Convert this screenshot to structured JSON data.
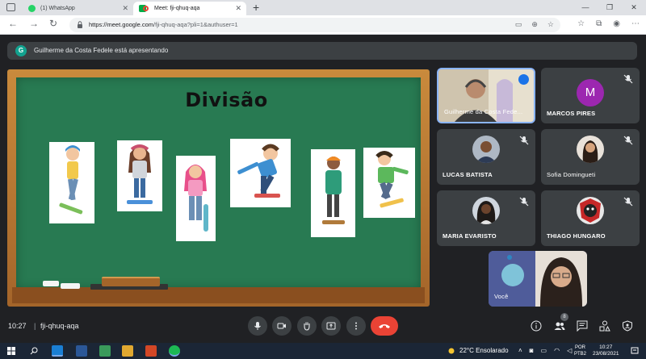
{
  "browser": {
    "tabs": [
      {
        "title": "(1) WhatsApp",
        "icon": "whatsapp-icon",
        "active": false
      },
      {
        "title": "Meet: fji-qhuq-aqa",
        "icon": "meet-icon",
        "active": true
      }
    ],
    "url_host": "https://meet.google.com",
    "url_path": "/fji-qhuq-aqa?pli=1&authuser=1"
  },
  "presenting": {
    "avatar_letter": "G",
    "text": "Guilherme da Costa Fedele está apresentando"
  },
  "presentation": {
    "title": "Divisão"
  },
  "participants": [
    {
      "name": "Guilherme da Costa Fedele",
      "display": "Guilherme da Costa Fede...",
      "muted": false,
      "speaking": true
    },
    {
      "name": "MARCOS PIRES",
      "avatar_letter": "M",
      "muted": true
    },
    {
      "name": "LUCAS BATISTA",
      "muted": true
    },
    {
      "name": "Sofia Domingueti",
      "muted": true
    },
    {
      "name": "MARIA EVARISTO",
      "muted": true
    },
    {
      "name": "THIAGO HUNGARO",
      "muted": true
    },
    {
      "name": "Você",
      "muted": false
    }
  ],
  "controls": {
    "time": "10:27",
    "separator": "|",
    "meeting_code": "fji-qhuq-aqa",
    "people_count": "8"
  },
  "taskbar": {
    "weather": "22°C  Ensolarado",
    "lang_top": "POR",
    "lang_bottom": "PTB2",
    "time": "10:27",
    "date": "23/08/2021"
  },
  "colors": {
    "meet_bg": "#202124",
    "tile_bg": "#3c4043",
    "end_call": "#ea4335",
    "chalkboard": "#287a52",
    "board_frame": "#a4652a",
    "speaker_border": "#8ab4f8"
  }
}
